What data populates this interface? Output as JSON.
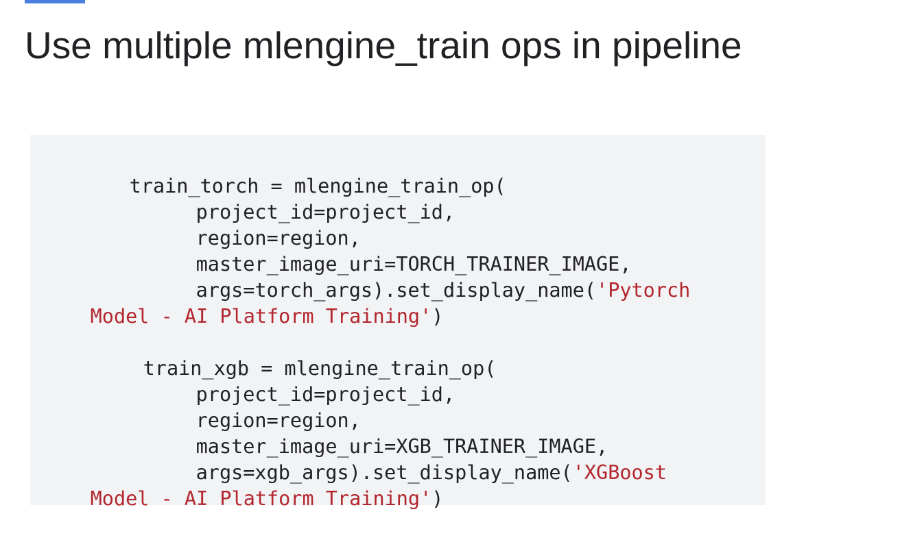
{
  "slide": {
    "title": "Use multiple mlengine_train ops in pipeline"
  },
  "code_block": {
    "lines": [
      {
        "text": "train_torch = mlengine_train_op(",
        "string_part": ""
      },
      {
        "text": "project_id=project_id,",
        "string_part": ""
      },
      {
        "text": "region=region,",
        "string_part": ""
      },
      {
        "text": "master_image_uri=TORCH_TRAINER_IMAGE,",
        "string_part": ""
      },
      {
        "text": "args=torch_args).set_display_name(",
        "string_part": "'Pytorch"
      },
      {
        "text": "",
        "string_part": "Model - AI Platform Training'",
        "tail": ")"
      },
      {
        "text": "train_xgb = mlengine_train_op(",
        "string_part": ""
      },
      {
        "text": "project_id=project_id,",
        "string_part": ""
      },
      {
        "text": "region=region,",
        "string_part": ""
      },
      {
        "text": "master_image_uri=XGB_TRAINER_IMAGE,",
        "string_part": ""
      },
      {
        "text": "args=xgb_args).set_display_name(",
        "string_part": "'XGBoost"
      },
      {
        "text": "",
        "string_part": "Model - AI Platform Training'",
        "tail": ")"
      }
    ]
  },
  "colors": {
    "accent": "#4a7fe0",
    "code_background": "#f1f3f4",
    "code_text": "#202124",
    "string_literal": "#b3262e"
  }
}
